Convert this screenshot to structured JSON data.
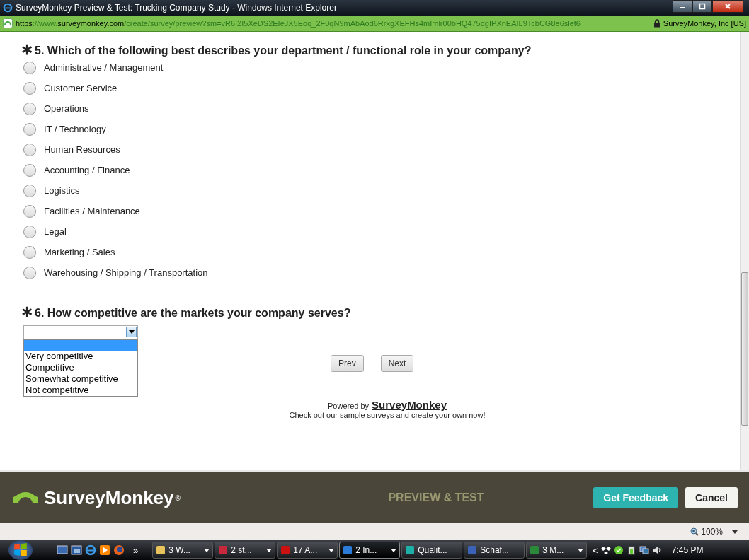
{
  "window": {
    "title": "SurveyMonkey Preview & Test: Trucking Company Study - Windows Internet Explorer"
  },
  "address_bar": {
    "parts": [
      {
        "text": "https",
        "kind": "strong"
      },
      {
        "text": "://www.",
        "kind": "dim"
      },
      {
        "text": "surveymonkey.com",
        "kind": "strong"
      },
      {
        "text": "/create/survey/preview?sm=vR6I2I5XeDS2EIeJX5Eoq_2F0qN9mAbAod6RrxgXEFHs4mImlr00bHQ475dgIPXnEAIL9TcbCG8e6slef6",
        "kind": "dim"
      }
    ],
    "certificate": "SurveyMonkey, Inc [US]"
  },
  "questions": [
    {
      "kind": "radio",
      "required_mark": "∗",
      "title": "5. Which of the following best describes your department / functional role in your company?",
      "options": [
        {
          "label": "Administrative / Management",
          "selected": false
        },
        {
          "label": "Customer Service",
          "selected": false
        },
        {
          "label": "Operations",
          "selected": false
        },
        {
          "label": "IT / Technology",
          "selected": false
        },
        {
          "label": "Human Resources",
          "selected": false
        },
        {
          "label": "Accounting / Finance",
          "selected": false
        },
        {
          "label": "Logistics",
          "selected": false
        },
        {
          "label": "Facilities / Maintenance",
          "selected": false
        },
        {
          "label": "Legal",
          "selected": false
        },
        {
          "label": "Marketing / Sales",
          "selected": false
        },
        {
          "label": "Warehousing / Shipping / Transportation",
          "selected": false
        }
      ]
    },
    {
      "kind": "dropdown",
      "required_mark": "∗",
      "title": "6. How competitive are the markets your company serves?",
      "expanded": true,
      "blank_option_highlighted": true,
      "options": [
        {
          "label": "Very competitive",
          "selected": false
        },
        {
          "label": "Competitive",
          "selected": false
        },
        {
          "label": "Somewhat competitive",
          "selected": false
        },
        {
          "label": "Not competitive",
          "selected": false
        }
      ]
    }
  ],
  "nav_buttons": [
    "Prev",
    "Next"
  ],
  "powered_by": {
    "prefix": "Powered by",
    "brand": "SurveyMonkey"
  },
  "promo": {
    "before": "Check out our ",
    "link": "sample surveys",
    "after": " and create your own now!"
  },
  "preview_bar": {
    "logo": "SurveyMonkey",
    "logo_mark": "®",
    "mode": "PREVIEW & TEST",
    "buttons": [
      {
        "label": "Get Feedback",
        "kind": "primary"
      },
      {
        "label": "Cancel",
        "kind": "secondary"
      }
    ]
  },
  "status_bar": {
    "zoom": "100%"
  },
  "taskbar": {
    "overflow": "»",
    "tasks": [
      {
        "label": "3 W...",
        "kind": "folder",
        "selected": false,
        "menu": true
      },
      {
        "label": "2 st...",
        "kind": "sigma",
        "selected": false,
        "menu": true
      },
      {
        "label": "17 A...",
        "kind": "pdf",
        "selected": false,
        "menu": true
      },
      {
        "label": "2 In...",
        "kind": "ie",
        "selected": true,
        "menu": true
      },
      {
        "label": "Qualit...",
        "kind": "tree",
        "selected": false,
        "menu": false
      },
      {
        "label": "Schaf...",
        "kind": "word",
        "selected": false,
        "menu": false
      },
      {
        "label": "3 M...",
        "kind": "excel",
        "selected": false,
        "menu": true
      }
    ],
    "tray_arrow": "<",
    "time": "7:45 PM"
  }
}
